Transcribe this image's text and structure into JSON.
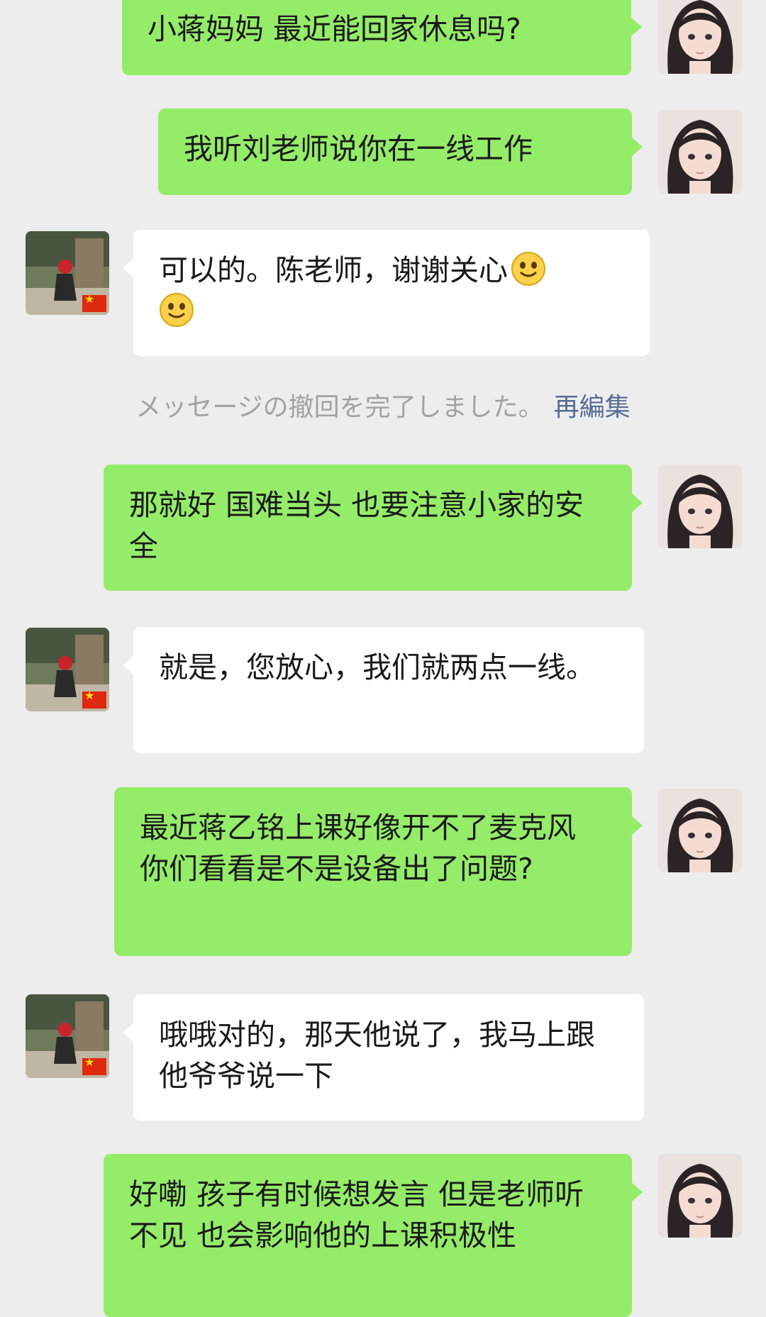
{
  "conversation": {
    "messages": [
      {
        "direction": "outgoing",
        "text": "小蒋妈妈 最近能回家休息吗?"
      },
      {
        "direction": "outgoing",
        "text": "我听刘老师说你在一线工作"
      },
      {
        "direction": "incoming",
        "text": "可以的。陈老师，谢谢关心",
        "emojis": [
          "smile-emoji",
          "smile-emoji"
        ]
      },
      {
        "direction": "outgoing",
        "text": "那就好 国难当头 也要注意小家的安全"
      },
      {
        "direction": "incoming",
        "text": "就是，您放心，我们就两点一线。"
      },
      {
        "direction": "outgoing",
        "text": "最近蒋乙铭上课好像开不了麦克风 你们看看是不是设备出了问题?"
      },
      {
        "direction": "incoming",
        "text": "哦哦对的，那天他说了，我马上跟他爷爷说一下"
      },
      {
        "direction": "outgoing",
        "text": "好嘞 孩子有时候想发言 但是老师听不见 也会影响他的上课积极性"
      }
    ],
    "system_notice": {
      "text": "メッセージの撤回を完了しました。",
      "action": "再編集"
    }
  },
  "icons": {
    "outgoing_avatar": "anime-girl-avatar-icon",
    "incoming_avatar": "parent-photo-avatar-icon",
    "flag_badge": "china-flag-icon",
    "emoji": "smile-emoji"
  },
  "colors": {
    "background": "#ededed",
    "outgoing_bubble": "#95ec69",
    "incoming_bubble": "#ffffff",
    "system_text": "#a2a2a2",
    "link": "#576b95"
  }
}
